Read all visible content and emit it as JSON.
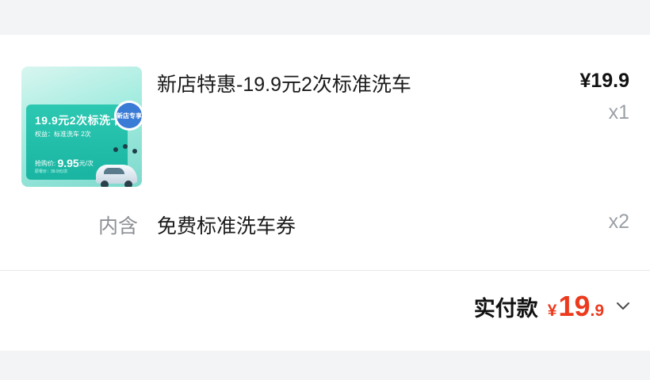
{
  "order": {
    "product": {
      "title": "新店特惠-19.9元2次标准洗车",
      "price": "¥19.9",
      "quantity": "x1",
      "thumbnail": {
        "banner_title": "19.9元2次标洗卡",
        "benefit_line": "权益：标准洗车 2次",
        "price_label": "抢购价: ",
        "price_value": "9.95",
        "price_unit": "元/次",
        "original_price": "原零价：39.9元/次",
        "badge": "新店专享"
      }
    },
    "contains": {
      "label": "内含",
      "item": "免费标准洗车券",
      "quantity": "x2"
    },
    "total": {
      "label": "实付款",
      "currency": "¥",
      "amount_int": "19",
      "amount_dec": ".9"
    }
  },
  "colors": {
    "accent_red": "#ec3a1e",
    "thumb_teal": "#19b5a2"
  },
  "icons": {
    "expand": "chevron-down-icon"
  }
}
